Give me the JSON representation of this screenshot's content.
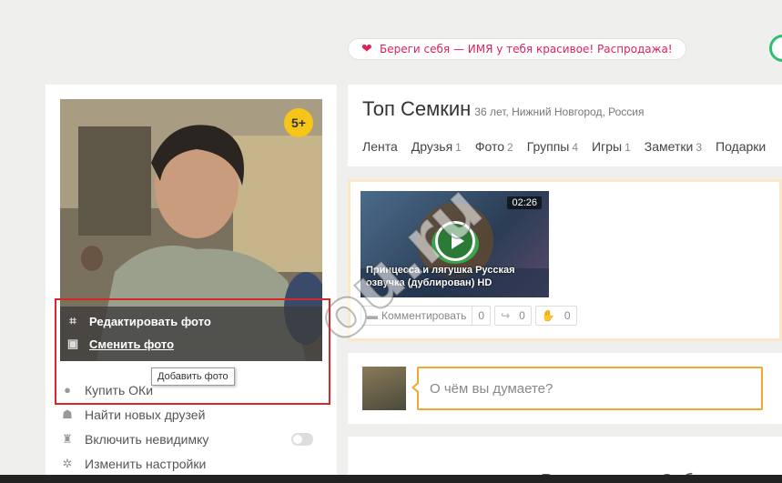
{
  "promo": {
    "text": "Береги себя — ИМЯ у тебя красивое! Распродажа!"
  },
  "profile": {
    "name": "Топ Семкин",
    "meta": "36 лет, Нижний Новгород, Россия",
    "badge": "5+",
    "photo_actions": {
      "edit": "Редактировать фото",
      "change": "Сменить фото"
    },
    "tooltip": "Добавить фото"
  },
  "sidebar": {
    "items": [
      {
        "label": "Купить ОКи",
        "icon": "ok-coin-icon"
      },
      {
        "label": "Найти новых друзей",
        "icon": "person-icon"
      },
      {
        "label": "Включить невидимку",
        "icon": "hat-icon",
        "toggle": false
      },
      {
        "label": "Изменить настройки",
        "icon": "gear-icon"
      }
    ]
  },
  "tabs": [
    {
      "label": "Лента",
      "count": ""
    },
    {
      "label": "Друзья",
      "count": "1"
    },
    {
      "label": "Фото",
      "count": "2"
    },
    {
      "label": "Группы",
      "count": "4"
    },
    {
      "label": "Игры",
      "count": "1"
    },
    {
      "label": "Заметки",
      "count": "3"
    },
    {
      "label": "Подарки",
      "count": ""
    }
  ],
  "video": {
    "duration": "02:26",
    "title": "Принцесса и лягушка Русская озвучка (дублирован) HD"
  },
  "actions": {
    "comment_label": "Комментировать",
    "comment_count": "0",
    "share_count": "0",
    "like_count": "0"
  },
  "post": {
    "placeholder": "О чём вы думаете?"
  },
  "lower": {
    "text": "Расскажите о Себе"
  },
  "watermark": "ou.ru"
}
